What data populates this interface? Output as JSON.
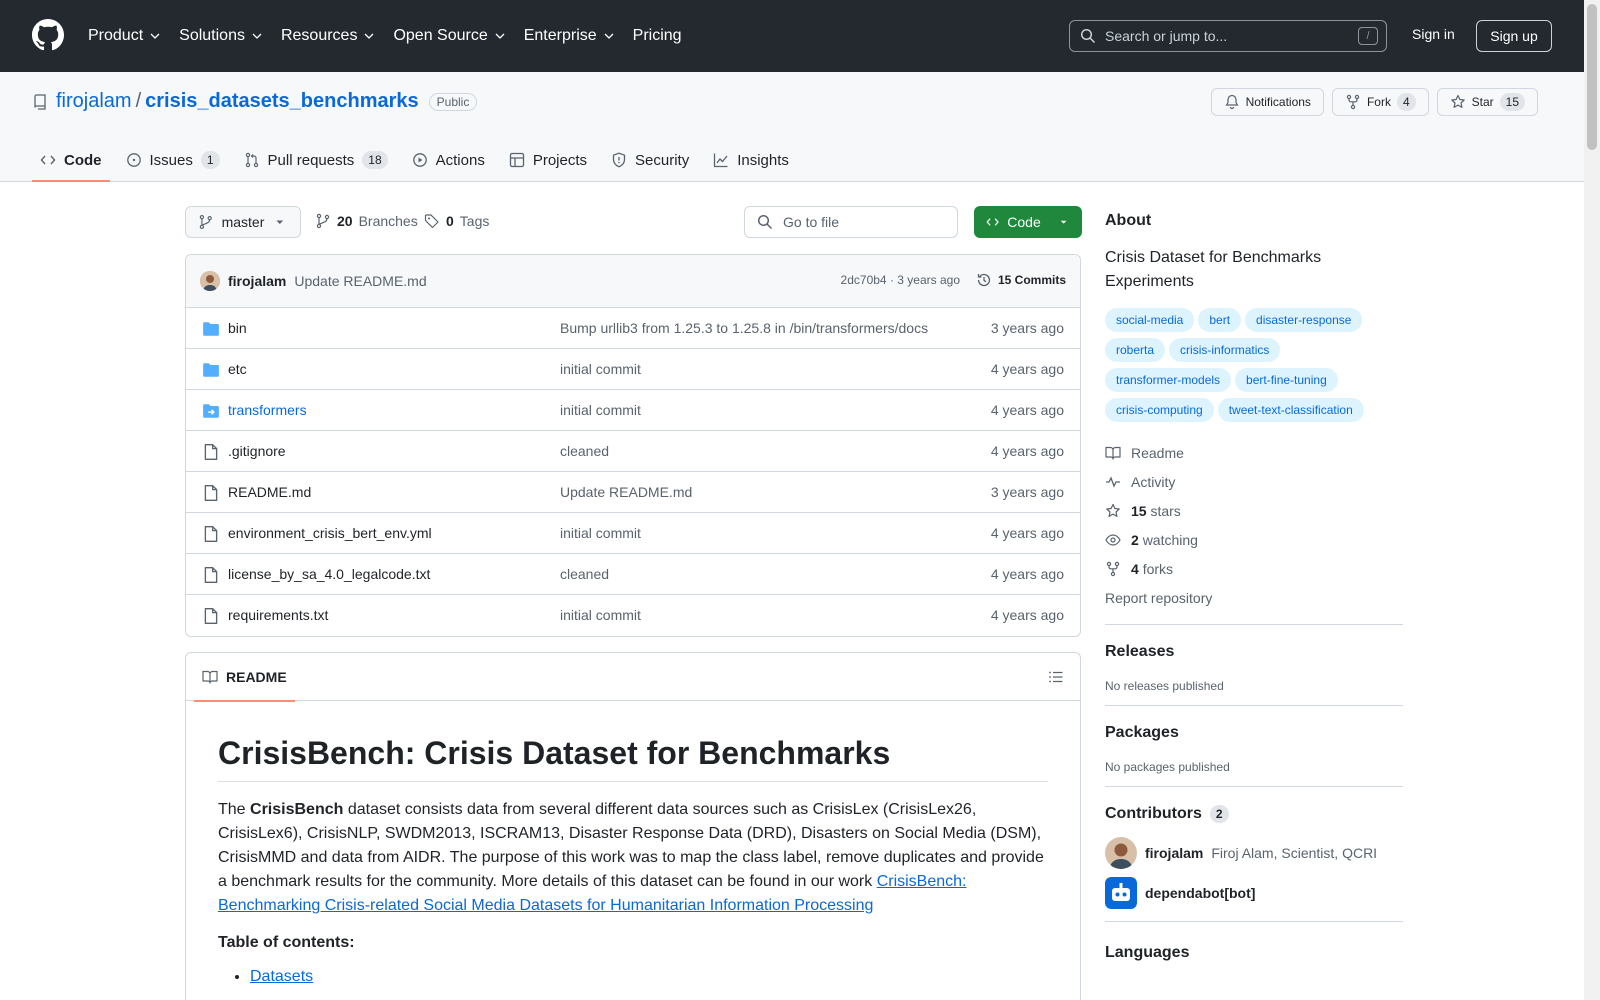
{
  "global_nav": {
    "items": [
      "Product",
      "Solutions",
      "Resources",
      "Open Source",
      "Enterprise",
      "Pricing"
    ],
    "search_placeholder": "Search or jump to...",
    "search_shortcut": "/",
    "sign_in": "Sign in",
    "sign_up": "Sign up"
  },
  "repo": {
    "owner": "firojalam",
    "separator": "/",
    "name": "crisis_datasets_benchmarks",
    "visibility": "Public",
    "actions": {
      "notifications": "Notifications",
      "fork": "Fork",
      "fork_count": "4",
      "star": "Star",
      "star_count": "15"
    },
    "tabs": [
      {
        "label": "Code",
        "count": ""
      },
      {
        "label": "Issues",
        "count": "1"
      },
      {
        "label": "Pull requests",
        "count": "18"
      },
      {
        "label": "Actions",
        "count": ""
      },
      {
        "label": "Projects",
        "count": ""
      },
      {
        "label": "Security",
        "count": ""
      },
      {
        "label": "Insights",
        "count": ""
      }
    ]
  },
  "toolbar": {
    "branch": "master",
    "branches_count": "20",
    "branches_label": "Branches",
    "tags_count": "0",
    "tags_label": "Tags",
    "go_to_file": "Go to file",
    "code_button": "Code"
  },
  "latest_commit": {
    "author": "firojalam",
    "message": "Update README.md",
    "hash": "2dc70b4",
    "dot": "·",
    "time": "3 years ago",
    "commits": "15 Commits"
  },
  "files": [
    {
      "name": "bin",
      "type": "folder",
      "message": "Bump urllib3 from 1.25.3 to 1.25.8 in /bin/transformers/docs",
      "date": "3 years ago"
    },
    {
      "name": "etc",
      "type": "folder",
      "message": "initial commit",
      "date": "4 years ago"
    },
    {
      "name": "transformers",
      "type": "submodule",
      "message": "initial commit",
      "date": "4 years ago"
    },
    {
      "name": ".gitignore",
      "type": "file",
      "message": "cleaned",
      "date": "4 years ago"
    },
    {
      "name": "README.md",
      "type": "file",
      "message": "Update README.md",
      "date": "3 years ago"
    },
    {
      "name": "environment_crisis_bert_env.yml",
      "type": "file",
      "message": "initial commit",
      "date": "4 years ago"
    },
    {
      "name": "license_by_sa_4.0_legalcode.txt",
      "type": "file",
      "message": "cleaned",
      "date": "4 years ago"
    },
    {
      "name": "requirements.txt",
      "type": "file",
      "message": "initial commit",
      "date": "4 years ago"
    }
  ],
  "readme": {
    "tab": "README",
    "title": "CrisisBench: Crisis Dataset for Benchmarks",
    "p_prefix": "The ",
    "p_bold": "CrisisBench",
    "p_text": " dataset consists data from several different data sources such as CrisisLex (CrisisLex26, CrisisLex6), CrisisNLP, SWDM2013, ISCRAM13, Disaster Response Data (DRD), Disasters on Social Media (DSM), CrisisMMD and data from AIDR. The purpose of this work was to map the class label, remove duplicates and provide a benchmark results for the community. More details of this dataset can be found in our work ",
    "p_link": "CrisisBench: Benchmarking Crisis-related Social Media Datasets for Humanitarian Information Processing",
    "toc_heading": "Table of contents:",
    "toc_items": [
      "Datasets"
    ]
  },
  "sidebar": {
    "about_heading": "About",
    "description": "Crisis Dataset for Benchmarks Experiments",
    "topics": [
      "social-media",
      "bert",
      "disaster-response",
      "roberta",
      "crisis-informatics",
      "transformer-models",
      "bert-fine-tuning",
      "crisis-computing",
      "tweet-text-classification"
    ],
    "readme": "Readme",
    "activity": "Activity",
    "stars_count": "15",
    "stars_label": "stars",
    "watching_count": "2",
    "watching_label": "watching",
    "forks_count": "4",
    "forks_label": "forks",
    "report": "Report repository",
    "releases_heading": "Releases",
    "releases_text": "No releases published",
    "packages_heading": "Packages",
    "packages_text": "No packages published",
    "contributors_heading": "Contributors",
    "contributors_count": "2",
    "contributors": [
      {
        "login": "firojalam",
        "desc": "Firoj Alam, Scientist, QCRI"
      },
      {
        "login": "dependabot[bot]",
        "desc": ""
      }
    ],
    "languages_heading": "Languages"
  },
  "colors": {
    "header_bg": "#24292f",
    "accent_link": "#0969da",
    "primary_button": "#1f883d",
    "tab_underline": "#fd8c73",
    "topic_bg": "#ddf4ff"
  }
}
